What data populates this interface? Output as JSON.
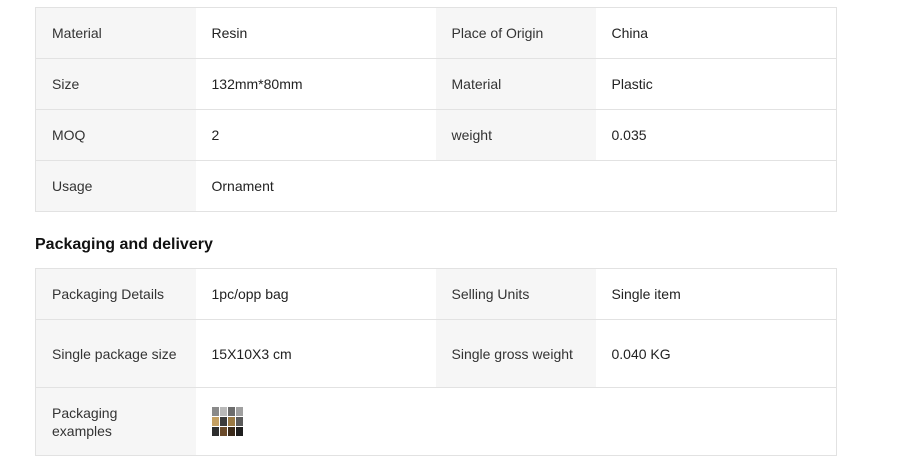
{
  "attributes": {
    "rows": [
      [
        {
          "label": "Material",
          "value": "Resin"
        },
        {
          "label": "Place of Origin",
          "value": "China"
        }
      ],
      [
        {
          "label": "Size",
          "value": "132mm*80mm"
        },
        {
          "label": "Material",
          "value": "Plastic"
        }
      ],
      [
        {
          "label": "MOQ",
          "value": "2"
        },
        {
          "label": "weight",
          "value": "0.035"
        }
      ],
      [
        {
          "label": "Usage",
          "value": "Ornament"
        }
      ]
    ]
  },
  "packaging": {
    "title": "Packaging and delivery",
    "details_label": "Packaging Details",
    "details_value": "1pc/opp bag",
    "units_label": "Selling Units",
    "units_value": "Single item",
    "size_label": "Single package size",
    "size_value": "15X10X3 cm",
    "gross_label": "Single gross weight",
    "gross_value": "0.040 KG",
    "examples_label": "Packaging examples",
    "examples_icon": "packaging-photo-thumbnail",
    "thumb_colors": [
      "#8a8a8a",
      "#b9b9b9",
      "#6d6d6d",
      "#a0a0a0",
      "#c4a062",
      "#3b3b3b",
      "#9a7a45",
      "#5b5b5b",
      "#2e2e2e",
      "#6b4b2a",
      "#3a2a1a",
      "#1e1e1e"
    ]
  }
}
